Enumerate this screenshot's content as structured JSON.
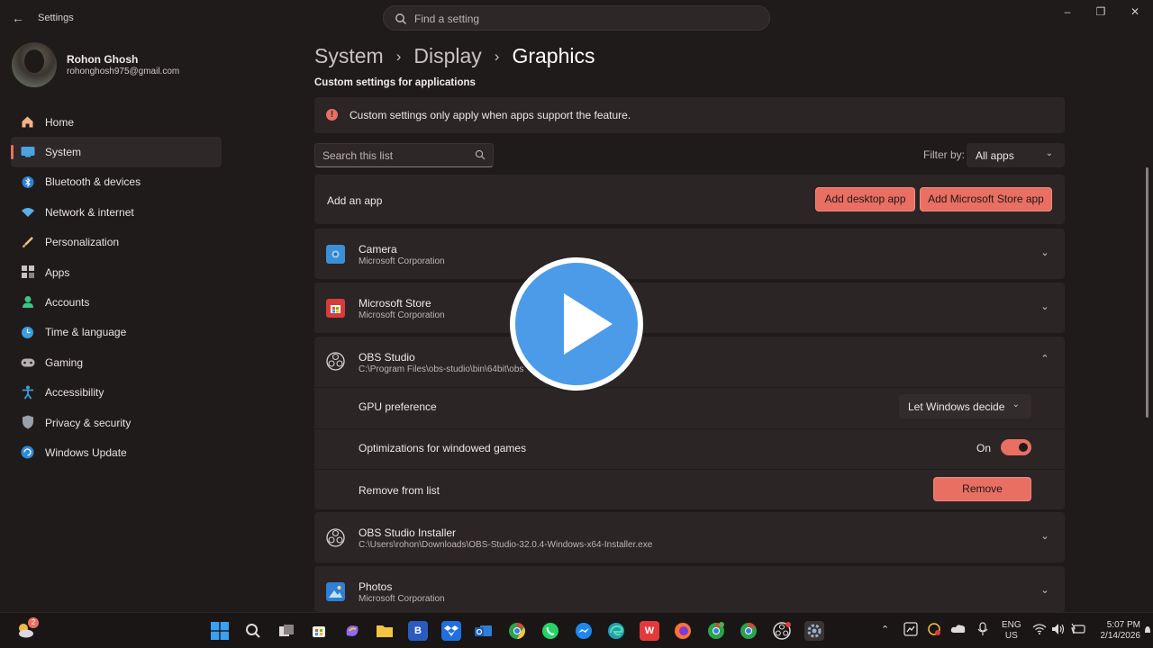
{
  "window": {
    "title": "Settings",
    "search_placeholder": "Find a setting"
  },
  "user": {
    "name": "Rohon Ghosh",
    "email": "rohonghosh975@gmail.com"
  },
  "nav": [
    {
      "label": "Home",
      "icon": "home-icon",
      "active": false
    },
    {
      "label": "System",
      "icon": "system-icon",
      "active": true
    },
    {
      "label": "Bluetooth & devices",
      "icon": "bluetooth-icon",
      "active": false
    },
    {
      "label": "Network & internet",
      "icon": "wifi-icon",
      "active": false
    },
    {
      "label": "Personalization",
      "icon": "brush-icon",
      "active": false
    },
    {
      "label": "Apps",
      "icon": "apps-icon",
      "active": false
    },
    {
      "label": "Accounts",
      "icon": "account-icon",
      "active": false
    },
    {
      "label": "Time & language",
      "icon": "globe-clock-icon",
      "active": false
    },
    {
      "label": "Gaming",
      "icon": "gamepad-icon",
      "active": false
    },
    {
      "label": "Accessibility",
      "icon": "accessibility-icon",
      "active": false
    },
    {
      "label": "Privacy & security",
      "icon": "shield-icon",
      "active": false
    },
    {
      "label": "Windows Update",
      "icon": "update-icon",
      "active": false
    }
  ],
  "breadcrumb": {
    "level1": "System",
    "level2": "Display",
    "current": "Graphics"
  },
  "section_title": "Custom settings for applications",
  "info": "Custom settings only apply when apps support the feature.",
  "list_search_placeholder": "Search this list",
  "filter": {
    "label": "Filter by:",
    "value": "All apps"
  },
  "add_app": {
    "label": "Add an app",
    "desktop_button": "Add desktop app",
    "store_button": "Add Microsoft Store app"
  },
  "apps": [
    {
      "name": "Camera",
      "publisher": "Microsoft Corporation",
      "icon": "camera-icon"
    },
    {
      "name": "Microsoft Store",
      "publisher": "Microsoft Corporation",
      "icon": "store-icon"
    },
    {
      "name": "OBS Studio",
      "publisher": "C:\\Program Files\\obs-studio\\bin\\64bit\\obs",
      "icon": "obs-icon"
    },
    {
      "name": "OBS Studio Installer",
      "publisher": "C:\\Users\\rohon\\Downloads\\OBS-Studio-32.0.4-Windows-x64-Installer.exe",
      "icon": "obs-icon"
    },
    {
      "name": "Photos",
      "publisher": "Microsoft Corporation",
      "icon": "photos-icon"
    }
  ],
  "expanded": {
    "gpu_label": "GPU preference",
    "gpu_value": "Let Windows decide",
    "opt_label": "Optimizations for windowed games",
    "opt_state": "On",
    "remove_label": "Remove from list",
    "remove_button": "Remove"
  },
  "taskbar": {
    "weather_badge": "2",
    "lang_line1": "ENG",
    "lang_line2": "US",
    "time": "5:07 PM",
    "date": "2/14/2026"
  },
  "colors": {
    "accent": "#e96f62",
    "background": "#201b1b",
    "card": "#2b2525",
    "play_button": "#4b9be8"
  }
}
